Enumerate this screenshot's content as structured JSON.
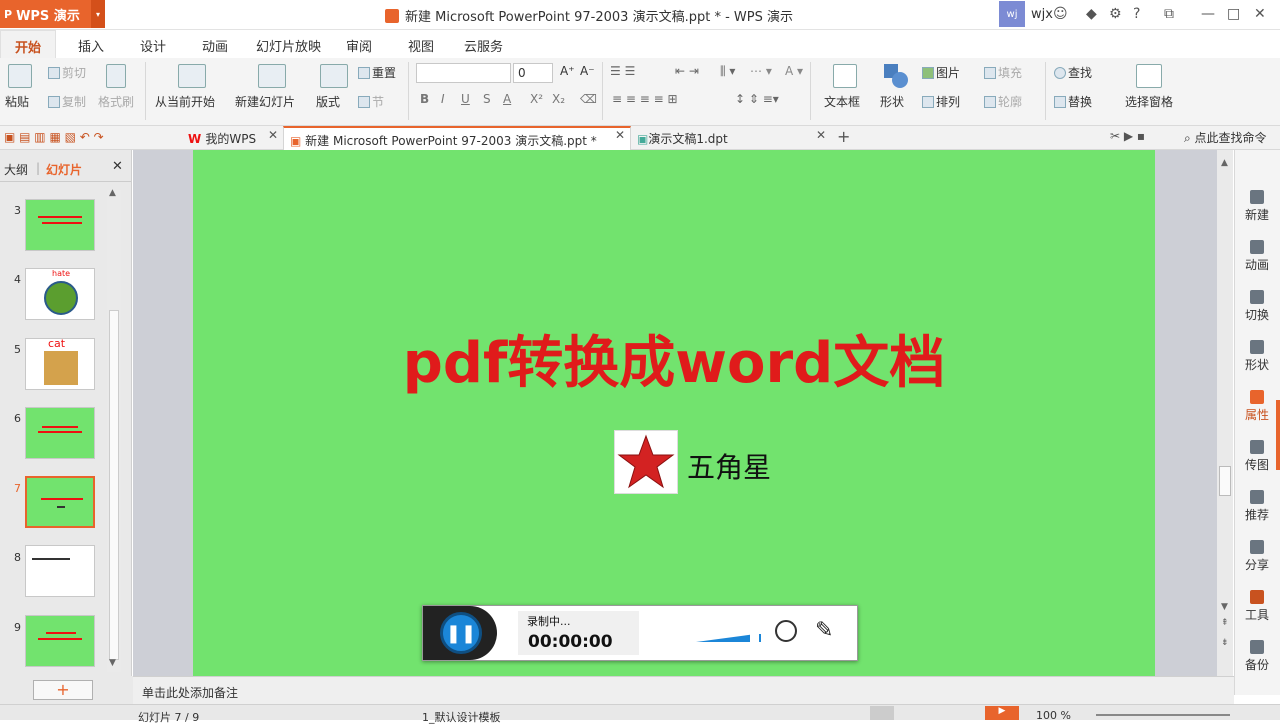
{
  "app": {
    "name": "WPS 演示",
    "window_title": "新建 Microsoft PowerPoint 97-2003 演示文稿.ppt * - WPS 演示",
    "user": "wjx",
    "user_badge": "wj",
    "help": "?"
  },
  "ribbon_tabs": [
    "开始",
    "插入",
    "设计",
    "动画",
    "幻灯片放映",
    "审阅",
    "视图",
    "云服务"
  ],
  "ribbon": {
    "paste": "粘贴",
    "cut": "剪切",
    "copy": "复制",
    "format_painter": "格式刷",
    "from_current": "从当前开始",
    "new_slide": "新建幻灯片",
    "layout": "版式",
    "reset": "重置",
    "section": "节",
    "font_size": "0",
    "bold": "B",
    "italic": "I",
    "underline": "U",
    "strike": "S",
    "fontcolor": "A",
    "grow": "A⁺",
    "shrink": "A⁻",
    "superscript": "X²",
    "subscript": "X₂",
    "textbox": "文本框",
    "shape": "形状",
    "picture": "图片",
    "arrange": "排列",
    "fill": "填充",
    "outline": "轮廓",
    "find": "查找",
    "replace": "替换",
    "selection_pane": "选择窗格"
  },
  "doc_tabs": [
    {
      "label": "我的WPS"
    },
    {
      "label": "新建 Microsoft PowerPoint 97-2003 演示文稿.ppt *"
    },
    {
      "label": "演示文稿1.dpt"
    }
  ],
  "search_cmd": "点此查找命令",
  "panel_tabs": {
    "outline": "大纲",
    "slides": "幻灯片"
  },
  "thumbnails": [
    {
      "num": "3"
    },
    {
      "num": "4",
      "text": "hate"
    },
    {
      "num": "5",
      "text": "cat"
    },
    {
      "num": "6"
    },
    {
      "num": "7"
    },
    {
      "num": "8"
    },
    {
      "num": "9"
    }
  ],
  "slide": {
    "title": "pdf转换成word文档",
    "star_label": "五角星",
    "background": "#72e36e",
    "title_color": "#e01b1b"
  },
  "recorder": {
    "status": "录制中...",
    "time": "00:00:00",
    "volume": 0.9
  },
  "right_panel": [
    "新建",
    "动画",
    "切换",
    "形状",
    "属性",
    "传图",
    "推荐",
    "分享",
    "工具",
    "备份"
  ],
  "notes_placeholder": "单击此处添加备注",
  "status": {
    "slide_of": "幻灯片 7 / 9",
    "template": "1_默认设计模板",
    "zoom": "100 %",
    "add_slide": "+"
  }
}
